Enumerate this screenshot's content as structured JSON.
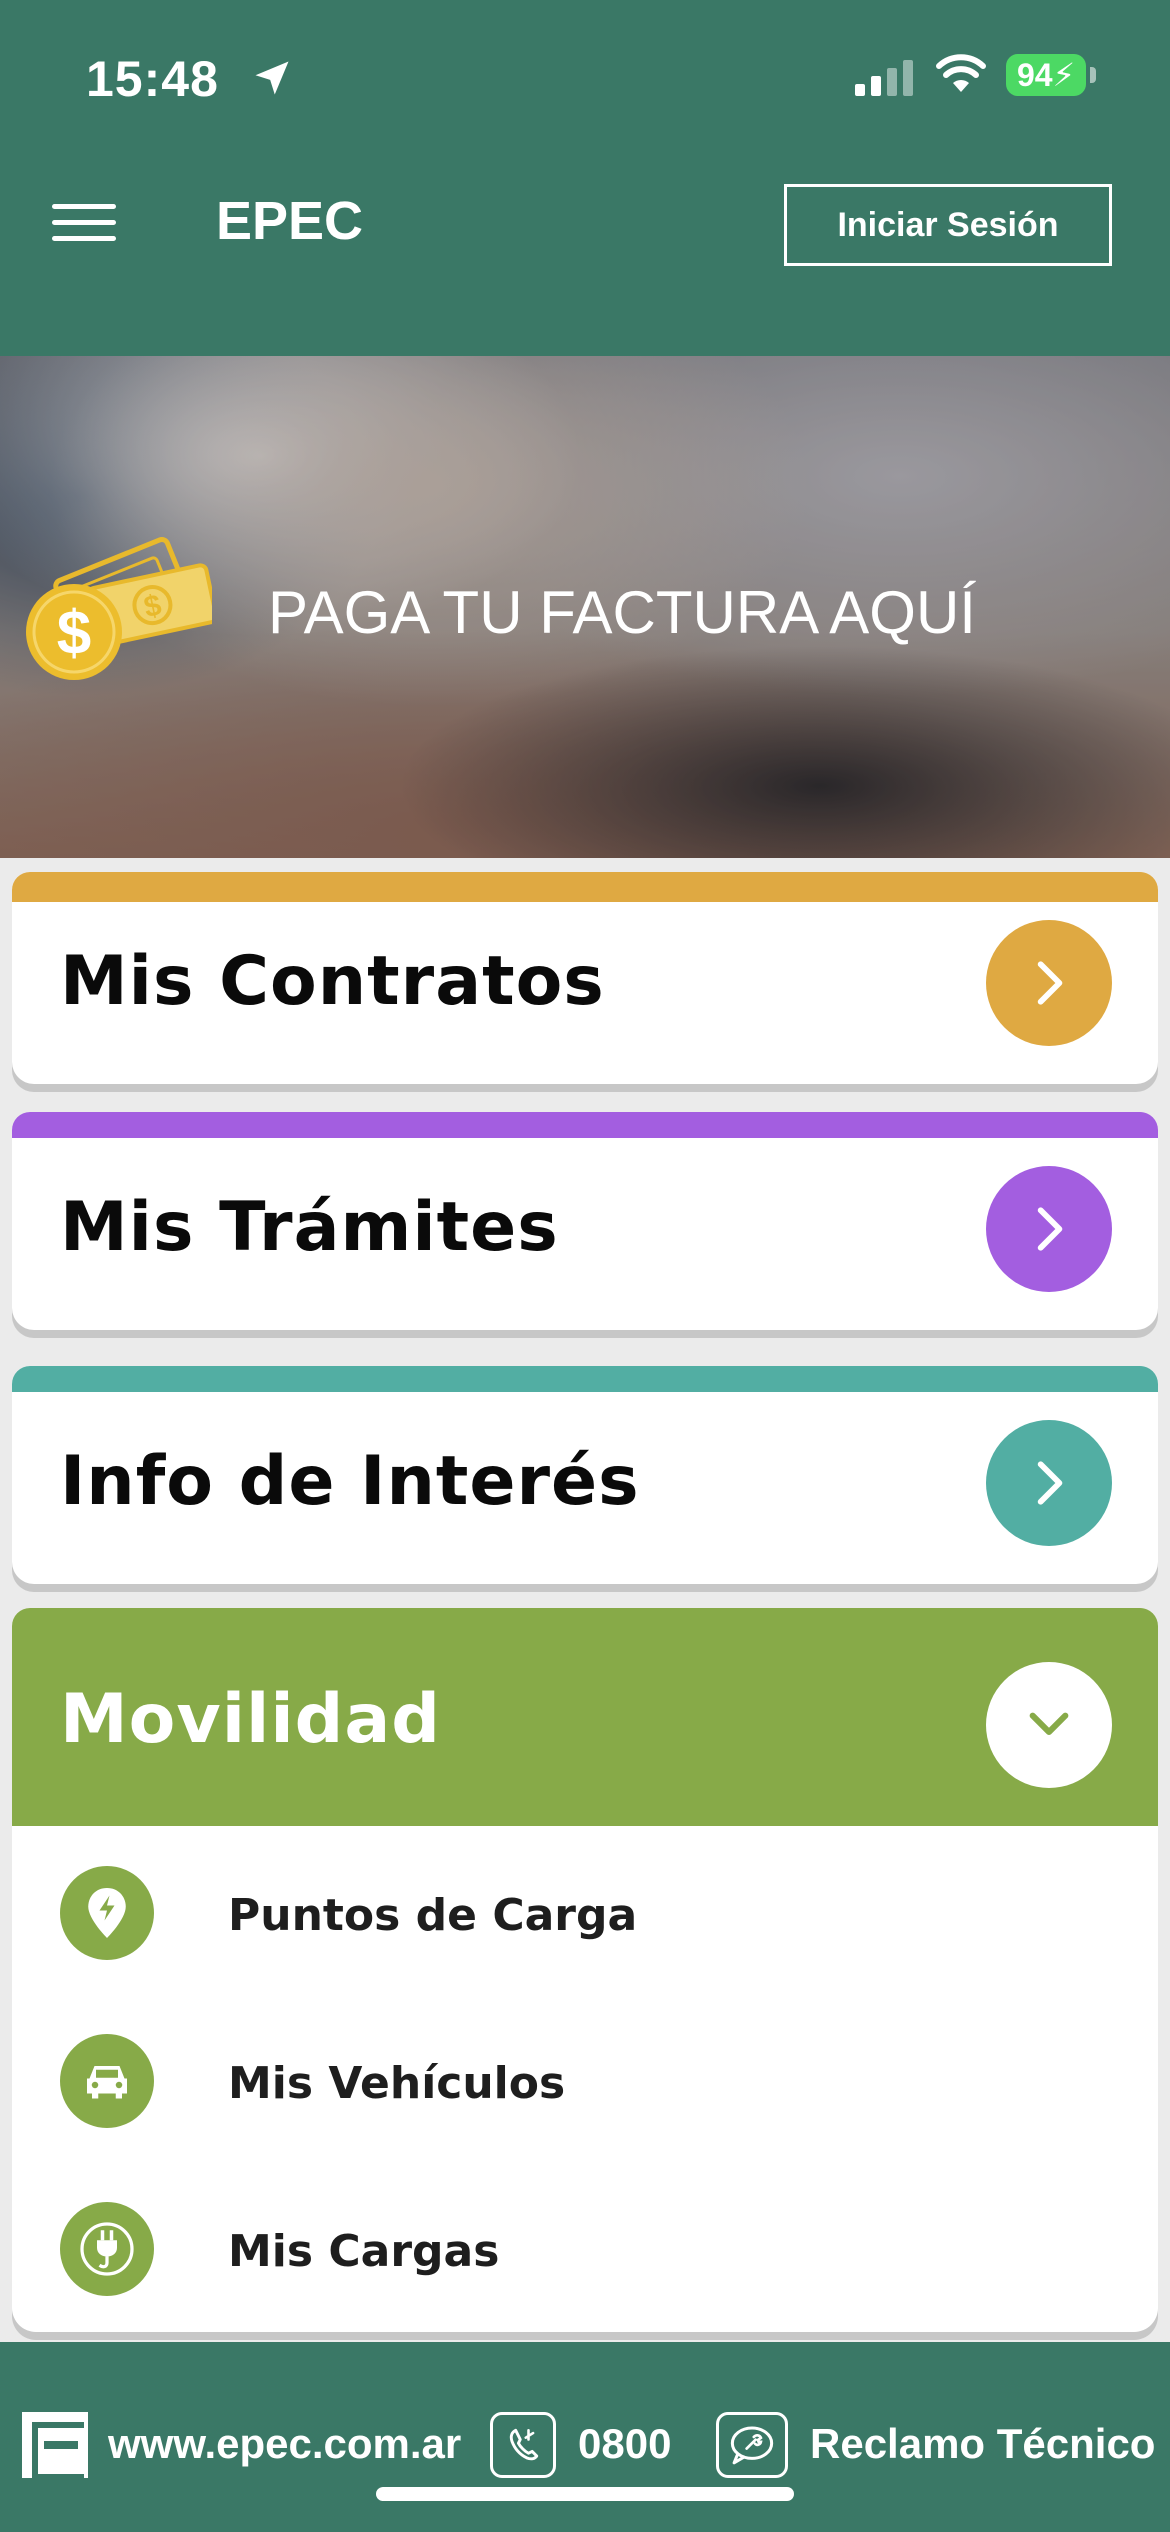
{
  "status_bar": {
    "time": "15:48",
    "battery": "94",
    "icons": [
      "location-arrow-icon",
      "signal-icon",
      "wifi-icon",
      "battery-charging-icon"
    ]
  },
  "header": {
    "menu_icon": "hamburger-menu-icon",
    "title": "EPEC",
    "login_label": "Iniciar Sesión"
  },
  "banner": {
    "text": "PAGA TU FACTURA AQUÍ",
    "icon": "coin-dollar-icon"
  },
  "cards": [
    {
      "title": "Mis Contratos",
      "color": "#dfa942"
    },
    {
      "title": "Mis Trámites",
      "color": "#a35ee0"
    },
    {
      "title": "Info de Interés",
      "color": "#52aea3"
    }
  ],
  "movilidad": {
    "title": "Movilidad",
    "color": "#87aa48",
    "toggle_icon": "chevron-down-icon",
    "items": [
      {
        "label": "Puntos de Carga",
        "icon": "charging-point-icon"
      },
      {
        "label": "Mis Vehículos",
        "icon": "car-icon"
      },
      {
        "label": "Mis Cargas",
        "icon": "plug-icon"
      }
    ]
  },
  "footer": {
    "website": "www.epec.com.ar",
    "phone": "0800",
    "claim": "Reclamo Técnico",
    "brand_color": "#3a7866"
  }
}
